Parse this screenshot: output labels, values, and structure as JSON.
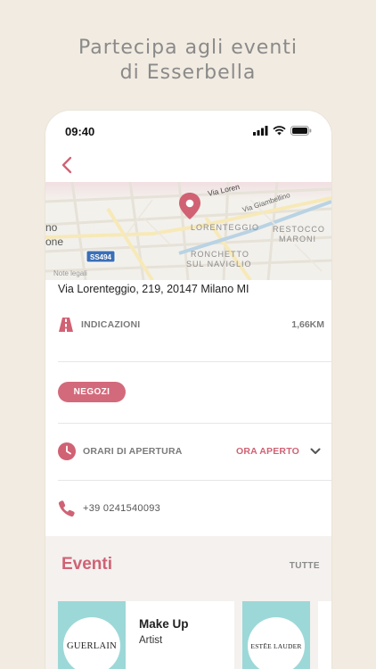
{
  "promo": {
    "line1": "Partecipa agli eventi",
    "line2": "di Esserbella"
  },
  "status_bar": {
    "time": "09:40"
  },
  "map": {
    "labels": {
      "street_top": "Via Loren",
      "street_giambellino": "Via Giambellino",
      "district_lorenteggio": "LORENTEGGIO",
      "district_restocco_1": "RESTOCCO",
      "district_restocco_2": "MARONI",
      "district_ronchetto_1": "RONCHETTO",
      "district_ronchetto_2": "SUL NAVIGLIO",
      "left_fragment_1": "no",
      "left_fragment_2": "one",
      "road_shield": "SS494",
      "legal": "Note legali"
    }
  },
  "store": {
    "address": "Via Lorenteggio, 219, 20147 Milano MI",
    "directions_label": "INDICAZIONI",
    "distance": "1,66KM",
    "category_pill": "NEGOZI",
    "hours_label": "ORARI DI APERTURA",
    "open_status": "ORA APERTO",
    "phone": "+39 0241540093"
  },
  "events": {
    "title": "Eventi",
    "all_label": "TUTTE",
    "cards": [
      {
        "brand": "GUERLAIN",
        "title": "Make Up",
        "subtitle": "Artist"
      },
      {
        "brand": "ESTĒE LAUDER"
      }
    ]
  },
  "colors": {
    "accent": "#d06274",
    "pill": "#d36a7c",
    "background": "#f2ebe1",
    "card_teal": "#9dd8d8"
  },
  "icons": [
    "back-chevron-icon",
    "map-pin-icon",
    "road-icon",
    "clock-icon",
    "chevron-down-icon",
    "phone-icon",
    "signal-icon",
    "wifi-icon",
    "battery-icon"
  ]
}
